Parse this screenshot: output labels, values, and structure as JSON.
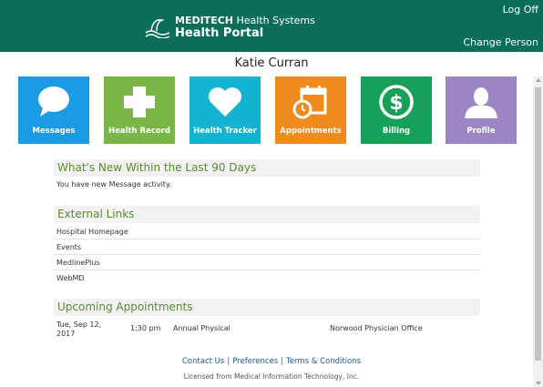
{
  "header": {
    "brand_name": "MEDITECH",
    "brand_suffix": "Health Systems",
    "portal_title": "Health Portal",
    "log_off": "Log Off",
    "change_person": "Change Person"
  },
  "user": {
    "name": "Katie Curran"
  },
  "tiles": [
    {
      "label": "Messages",
      "icon": "speech-bubble-icon",
      "color": "#1b9be4"
    },
    {
      "label": "Health Record",
      "icon": "medical-cross-icon",
      "color": "#79b547"
    },
    {
      "label": "Health Tracker",
      "icon": "heart-icon",
      "color": "#14b3d1"
    },
    {
      "label": "Appointments",
      "icon": "calendar-clock-icon",
      "color": "#ef8a1e"
    },
    {
      "label": "Billing",
      "icon": "dollar-icon",
      "color": "#17a05a"
    },
    {
      "label": "Profile",
      "icon": "person-icon",
      "color": "#9b85c2"
    }
  ],
  "whats_new": {
    "heading": "What's New Within the Last 90 Days",
    "message": "You have new Message activity."
  },
  "external_links": {
    "heading": "External Links",
    "items": [
      "Hospital Homepage",
      "Events",
      "MedlinePlus",
      "WebMD"
    ]
  },
  "appointments": {
    "heading": "Upcoming Appointments",
    "items": [
      {
        "date": "Tue, Sep 12, 2017",
        "time": "1:30 pm",
        "type": "Annual Physical",
        "location": "Norwood Physician Office"
      }
    ]
  },
  "footer": {
    "contact": "Contact Us",
    "preferences": "Preferences",
    "terms": "Terms & Conditions",
    "separator": "|",
    "license": "Licensed from Medical Information Technology, Inc."
  }
}
